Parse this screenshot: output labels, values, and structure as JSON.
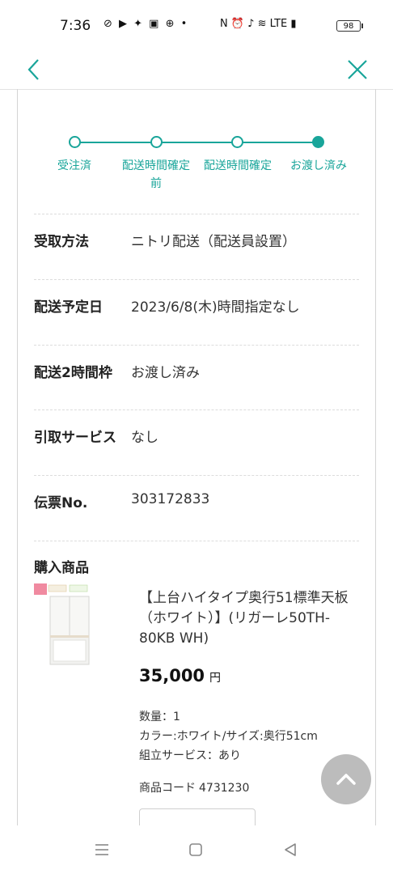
{
  "status_bar": {
    "time": "7:36",
    "left_icons": "⊘ ▶ ✦ ▣ ⊕ •",
    "right_icons": "N ⏰ ♪ ≋ LTE ▮",
    "battery": "98"
  },
  "nav": {
    "back_icon": "chevron-left",
    "close_icon": "close-x",
    "accent_color": "#19a59a"
  },
  "stepper": {
    "steps": [
      {
        "label": "受注済",
        "done": false
      },
      {
        "label": "配送時間確定前",
        "done": false
      },
      {
        "label": "配送時間確定",
        "done": false
      },
      {
        "label": "お渡し済み",
        "done": true
      }
    ]
  },
  "details": [
    {
      "label": "受取方法",
      "value": "ニトリ配送（配送員設置）"
    },
    {
      "label": "配送予定日",
      "value": "2023/6/8(木)時間指定なし"
    },
    {
      "label": "配送2時間枠",
      "value": "お渡し済み"
    },
    {
      "label": "引取サービス",
      "value": "なし"
    },
    {
      "label": "伝票No.",
      "value": "303172833"
    }
  ],
  "products": {
    "title": "購入商品",
    "items": [
      {
        "name": "【上台ハイタイプ奥行51標準天板（ホワイト）】(リガーレ50TH-80KB WH)",
        "price": "35,000",
        "currency": "円",
        "quantity": "数量：1",
        "attributes": "カラー:ホワイト/サイズ:奥行51cm",
        "assembly": "組立サービス：あり",
        "code_label": "商品コード",
        "code": "4731230"
      }
    ]
  },
  "scroll_top_icon": "chevron-up",
  "system_nav": {
    "menu_icon": "menu",
    "home_icon": "home-square",
    "back_icon": "back-triangle"
  }
}
